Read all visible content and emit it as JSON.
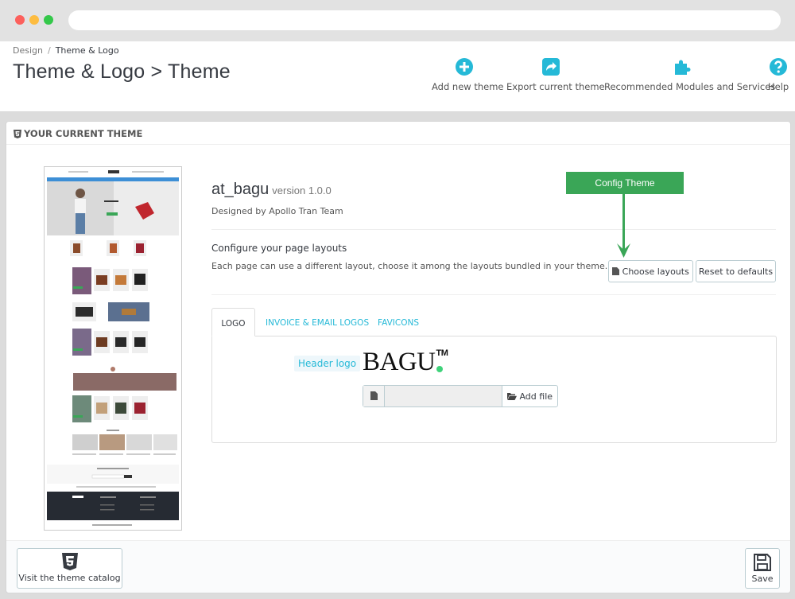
{
  "breadcrumb": {
    "parent": "Design",
    "separator": "/",
    "current": "Theme & Logo"
  },
  "page_title": "Theme & Logo > Theme",
  "toolbar": {
    "add_new_theme": "Add new theme",
    "export_current_theme": "Export current theme",
    "recommended_modules": "Recommended Modules and Services",
    "help": "Help"
  },
  "panel": {
    "heading": "YOUR CURRENT THEME"
  },
  "theme": {
    "name": "at_bagu",
    "version": "version 1.0.0",
    "designed_by": "Designed by Apollo Tran Team"
  },
  "layouts": {
    "title": "Configure your page layouts",
    "description": "Each page can use a different layout, choose it among the layouts bundled in your theme.",
    "choose_label": "Choose layouts",
    "reset_label": "Reset to defaults"
  },
  "callout": {
    "label": "Config Theme"
  },
  "tabs": [
    {
      "label": "LOGO",
      "active": true
    },
    {
      "label": "INVOICE & EMAIL LOGOS",
      "active": false
    },
    {
      "label": "FAVICONS",
      "active": false
    }
  ],
  "logo": {
    "header_logo_label": "Header logo",
    "logo_text": "BAGU",
    "logo_tm": "TM",
    "add_file_label": "Add file"
  },
  "footer": {
    "visit_catalog_label": "Visit the theme catalog",
    "save_label": "Save"
  },
  "colors": {
    "accent": "#25b9d7",
    "callout_green": "#3aa657",
    "text": "#363a41",
    "logo_dot": "#3fd27a"
  }
}
